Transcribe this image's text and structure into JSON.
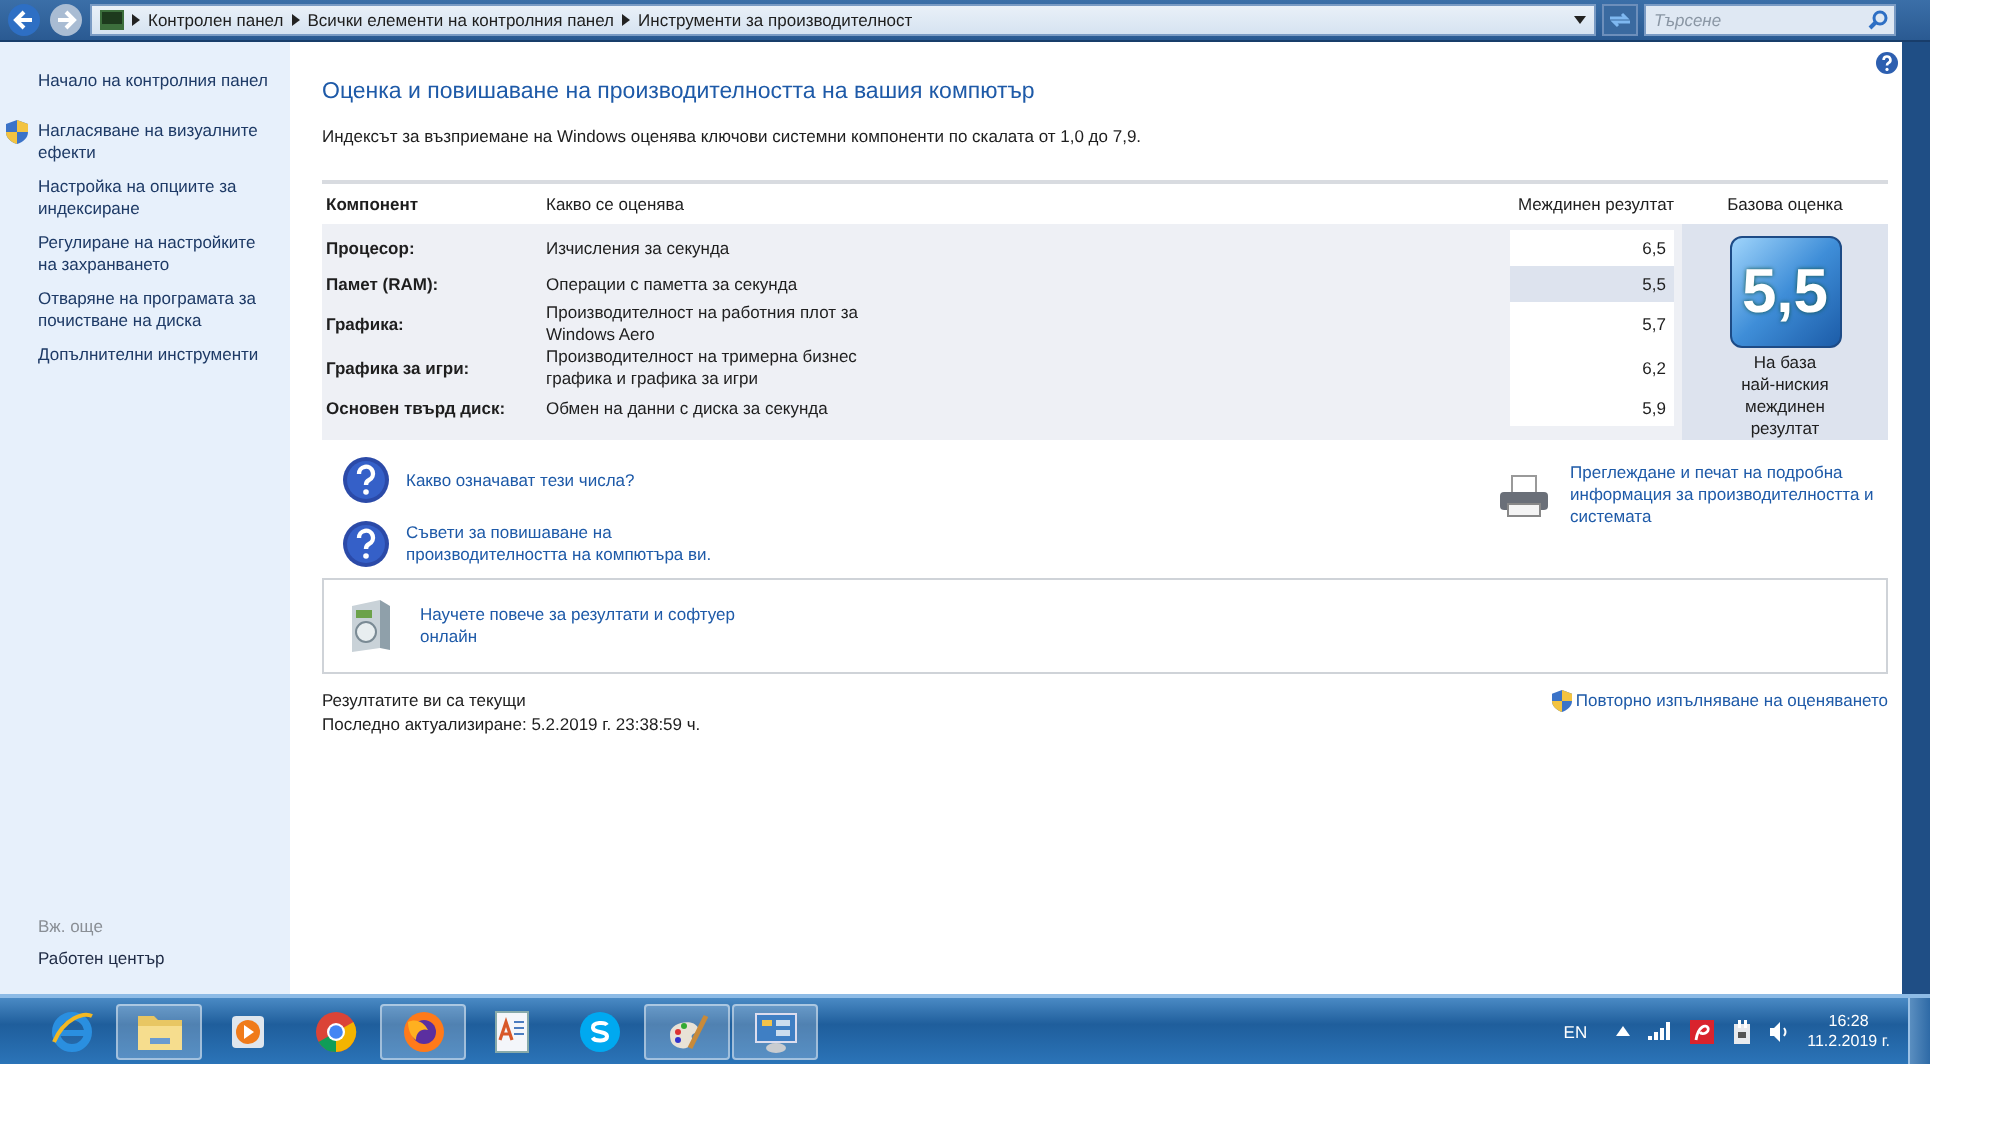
{
  "address_bar": {
    "breadcrumbs": [
      "Контролен панел",
      "Всички елементи на контролния панел",
      "Инструменти за производителност"
    ],
    "search": {
      "placeholder": "Търсене"
    }
  },
  "sidebar": {
    "links": [
      {
        "text": "Начало на контролния панел",
        "shield": false
      },
      {
        "text": "Нагласяване на визуалните ефекти",
        "shield": true
      },
      {
        "text": "Настройка на опциите за индексиране",
        "shield": false
      },
      {
        "text": "Регулиране на настройките на захранването",
        "shield": false
      },
      {
        "text": "Отваряне на програмата за почистване на диска",
        "shield": false
      },
      {
        "text": "Допълнителни инструменти",
        "shield": false
      }
    ],
    "see_also": {
      "heading": "Вж. още",
      "links": [
        "Работен център"
      ]
    }
  },
  "main": {
    "title": "Оценка и повишаване на производителността на вашия компютър",
    "intro": "Индексът за възприемане на Windows оценява ключови системни компоненти по скалата от 1,0 до 7,9.",
    "table": {
      "columns": [
        "Компонент",
        "Какво се оценява",
        "Междинен резултат",
        "Базова оценка"
      ],
      "rows": [
        {
          "component": "Процесор:",
          "rated": "Изчисления за секунда",
          "subscore": "6,5",
          "lowest": false
        },
        {
          "component": "Памет (RAM):",
          "rated": "Операции с паметта за секунда",
          "subscore": "5,5",
          "lowest": true
        },
        {
          "component": "Графика:",
          "rated": "Производителност на работния плот за Windows Aero",
          "subscore": "5,7",
          "lowest": false
        },
        {
          "component": "Графика за игри:",
          "rated": "Производителност на тримерна бизнес графика и графика за игри",
          "subscore": "6,2",
          "lowest": false
        },
        {
          "component": "Основен твърд диск:",
          "rated": "Обмен на данни с диска за секунда",
          "subscore": "5,9",
          "lowest": false
        }
      ],
      "base_score": {
        "value": "5,5",
        "caption": "На база\nнай-ниския\nмеждинен\nрезултат"
      }
    },
    "help_links": [
      "Какво означават тези числа?",
      "Съвети за повишаване на производителността на компютъра ви."
    ],
    "print_link": "Преглеждане и печат на подробна информация за производителността и системата",
    "learn_more": "Научете повече за резултати и софтуер онлайн",
    "status": [
      "Резултатите ви са текущи",
      "Последно актуализиране: 5.2.2019 г. 23:38:59 ч."
    ],
    "rerun_link": "Повторно изпълняване на оценяването"
  },
  "taskbar": {
    "apps": [
      {
        "kind": "ie",
        "running": false
      },
      {
        "kind": "folder",
        "running": true
      },
      {
        "kind": "media",
        "running": false
      },
      {
        "kind": "chrome",
        "running": false
      },
      {
        "kind": "firefox",
        "running": true
      },
      {
        "kind": "wordpad",
        "running": false
      },
      {
        "kind": "skype",
        "running": false
      },
      {
        "kind": "paint",
        "running": true
      },
      {
        "kind": "panel",
        "running": true
      }
    ],
    "language": "EN",
    "time": "16:28",
    "date": "11.2.2019 г."
  }
}
